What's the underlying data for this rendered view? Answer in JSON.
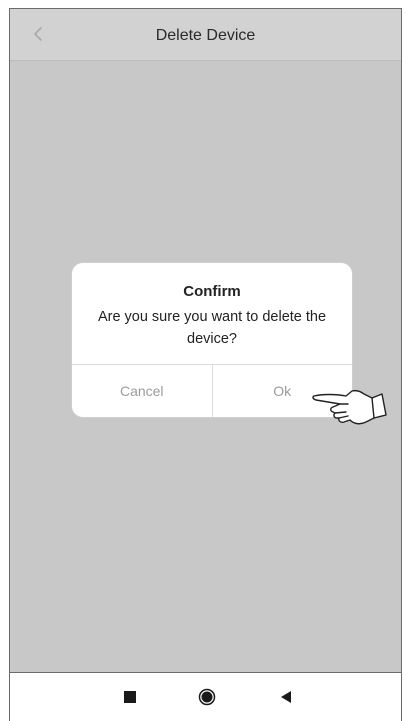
{
  "header": {
    "title": "Delete Device"
  },
  "dialog": {
    "title": "Confirm",
    "message": "Are you sure you want to delete the device?",
    "cancel_label": "Cancel",
    "ok_label": "Ok"
  },
  "icons": {
    "back": "chevron-left-icon",
    "pointer": "pointing-hand-icon",
    "nav_recent": "square-icon",
    "nav_home": "circle-icon",
    "nav_back": "triangle-back-icon"
  },
  "colors": {
    "overlay": "#c8c8c8",
    "dialog_bg": "#ffffff",
    "button_text": "#9b9b9b"
  }
}
